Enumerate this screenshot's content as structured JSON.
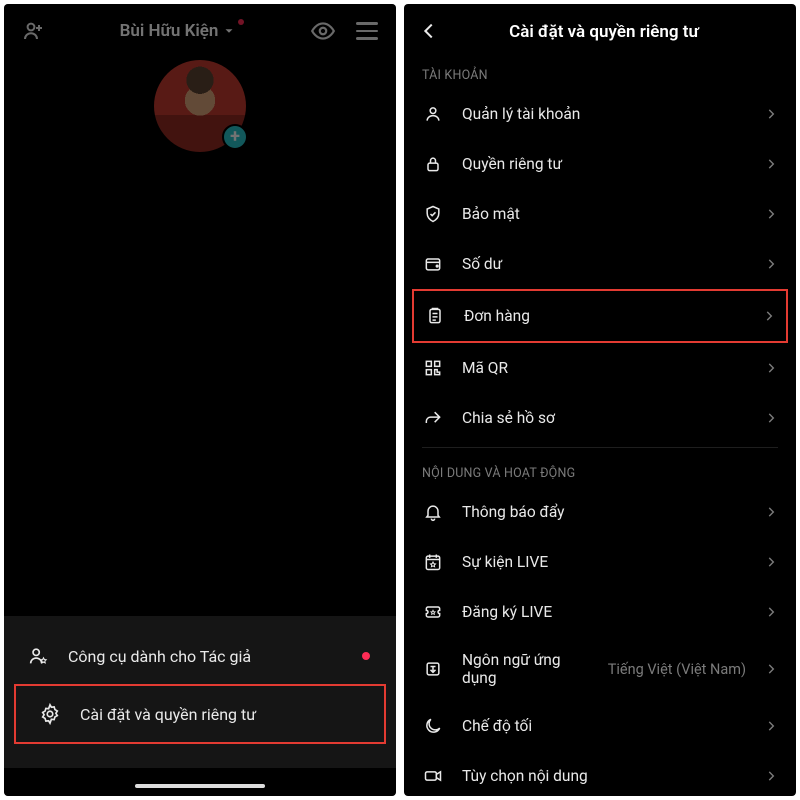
{
  "left": {
    "profile_name": "Bùi Hữu Kiện",
    "sheet": {
      "creator_tools": "Công cụ dành cho Tác giả",
      "settings_privacy": "Cài đặt và quyền riêng tư"
    }
  },
  "right": {
    "title": "Cài đặt và quyền riêng tư",
    "sections": [
      {
        "header": "TÀI KHOẢN",
        "items": [
          {
            "icon": "person",
            "label": "Quản lý tài khoản"
          },
          {
            "icon": "lock",
            "label": "Quyền riêng tư"
          },
          {
            "icon": "shield",
            "label": "Bảo mật"
          },
          {
            "icon": "wallet",
            "label": "Số dư"
          },
          {
            "icon": "orders",
            "label": "Đơn hàng",
            "highlighted": true
          },
          {
            "icon": "qr",
            "label": "Mã QR"
          },
          {
            "icon": "share",
            "label": "Chia sẻ hồ sơ"
          }
        ]
      },
      {
        "header": "NỘI DUNG VÀ HOẠT ĐỘNG",
        "items": [
          {
            "icon": "bell",
            "label": "Thông báo đẩy"
          },
          {
            "icon": "live-event",
            "label": "Sự kiện LIVE"
          },
          {
            "icon": "live-sub",
            "label": "Đăng ký LIVE"
          },
          {
            "icon": "language",
            "label": "Ngôn ngữ ứng dụng",
            "right_text": "Tiếng Việt (Việt Nam)"
          },
          {
            "icon": "moon",
            "label": "Chế độ tối"
          },
          {
            "icon": "video",
            "label": "Tùy chọn nội dung"
          }
        ]
      }
    ]
  }
}
